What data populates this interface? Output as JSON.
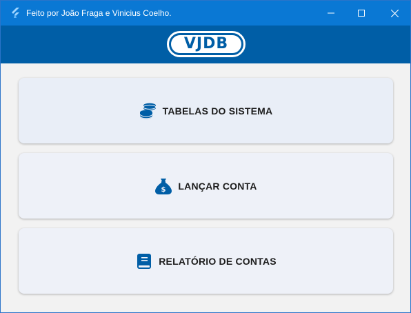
{
  "window": {
    "title": "Feito por João Fraga e Vinicius Coelho.",
    "app_icon": "flutter-icon",
    "controls": [
      "minimize-icon",
      "maximize-icon",
      "close-icon"
    ]
  },
  "header": {
    "logo_text": "VJDB"
  },
  "menu": {
    "items": [
      {
        "label": "TABELAS DO SISTEMA",
        "icon": "coins-stack-icon"
      },
      {
        "label": "LANÇAR CONTA",
        "icon": "money-bag-icon"
      },
      {
        "label": "RELATÓRIO DE CONTAS",
        "icon": "book-icon"
      }
    ]
  },
  "colors": {
    "titlebar": "#0a78d4",
    "appbar": "#005ea6",
    "card": "#eef1f8",
    "icon": "#005ea6",
    "background": "#f2f2f2"
  }
}
